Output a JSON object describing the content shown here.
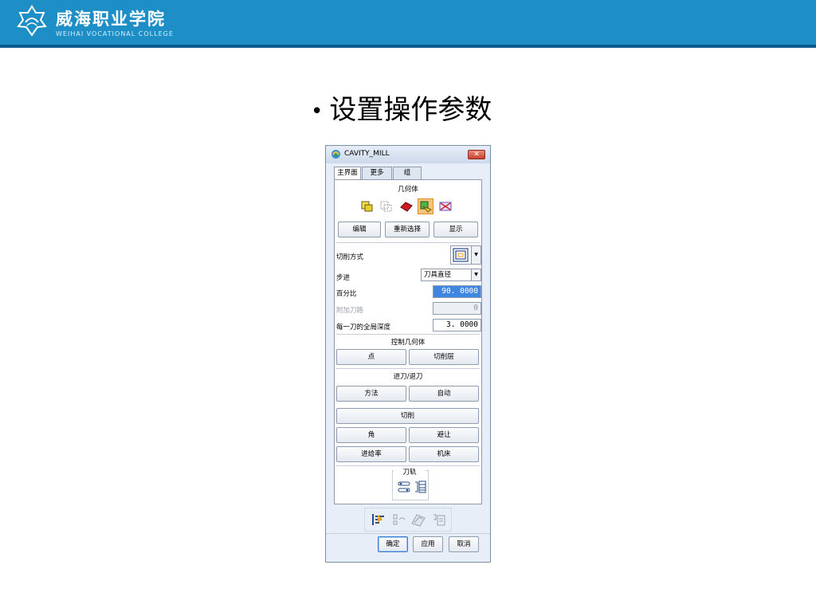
{
  "header": {
    "school_cn": "威海职业学院",
    "school_en": "WEIHAI VOCATIONAL COLLEGE"
  },
  "slide": {
    "bullet": "•",
    "title": "设置操作参数"
  },
  "dialog": {
    "title": "CAVITY_MILL",
    "close": "✕",
    "tabs": [
      "主界面",
      "更多",
      "组"
    ],
    "geometry": {
      "title": "几何体",
      "icons": [
        "specify-part-icon",
        "specify-blank-icon",
        "specify-check-icon",
        "specify-cut-area-icon",
        "specify-trim-boundary-icon"
      ],
      "buttons": [
        "编辑",
        "重新选择",
        "显示"
      ]
    },
    "params": {
      "cut_pattern_label": "切削方式",
      "stepover_label": "步进",
      "stepover_value": "刀具直径",
      "percent_label": "百分比",
      "percent_value": "90. 0000",
      "additional_passes_label": "附加刀路",
      "additional_passes_value": "0",
      "depth_label": "每一刀的全局深度",
      "depth_value": "3. 0000"
    },
    "control_geometry": {
      "title": "控制几何体",
      "buttons": [
        "点",
        "切削层"
      ]
    },
    "engage": {
      "title": "进刀/退刀",
      "buttons": [
        "方法",
        "自动"
      ]
    },
    "cut_button": "切削",
    "more_buttons": [
      "角",
      "避让",
      "进给率",
      "机床"
    ],
    "path": {
      "title": "刀轨",
      "icons": [
        "path-settings-icon",
        "path-list-icon"
      ]
    },
    "action_icons": [
      "generate-icon",
      "replay-icon",
      "verify-icon",
      "list-icon"
    ],
    "footer": [
      "确定",
      "应用",
      "取消"
    ]
  }
}
